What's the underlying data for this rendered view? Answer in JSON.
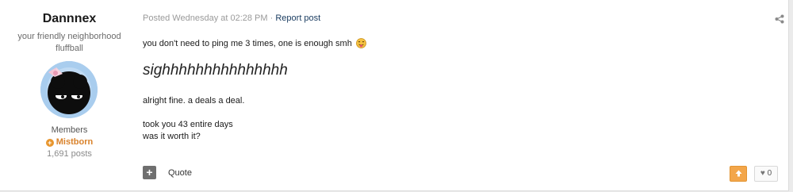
{
  "author": {
    "name": "Dannnex",
    "title": "your friendly neighborhood fluffball",
    "group": "Members",
    "rank": "Mistborn",
    "posts": "1,691 posts"
  },
  "meta": {
    "posted": "Posted Wednesday at 02:28 PM",
    "separator": "·",
    "report": "Report post"
  },
  "content": {
    "line1": "you don't need to ping me 3 times, one is enough smh",
    "sigh": "sighhhhhhhhhhhhhhh",
    "line3": "alright fine. a deals a deal.",
    "line4": "took you 43 entire days",
    "line5": "was it worth it?"
  },
  "actions": {
    "multiquote_symbol": "+",
    "quote": "Quote",
    "upvote_symbol": "🡅",
    "like_count": "0"
  },
  "icons": {
    "share": "share-icon",
    "rank": "plus-circle-icon",
    "emoji": "tongue-emoji-icon",
    "like": "heart-icon"
  },
  "colors": {
    "accent": "#f3a64a",
    "rank": "#d9822b",
    "link": "#1c3e62"
  }
}
